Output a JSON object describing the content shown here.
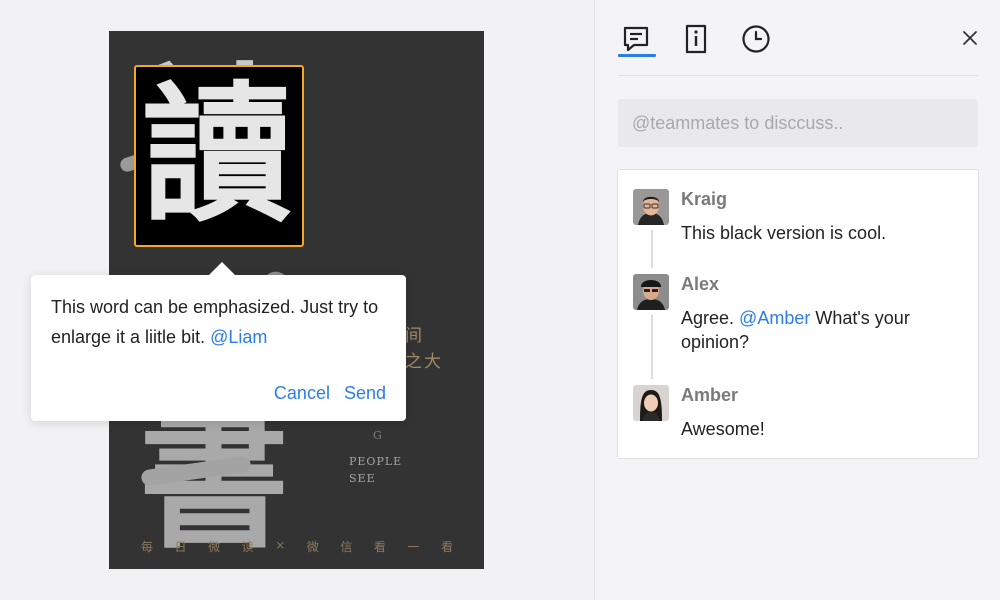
{
  "canvas": {
    "poster": {
      "title_glyph_1": "讀",
      "title_glyph_2": "書",
      "cjk_line_1": "间",
      "cjk_line_2": "之大",
      "en_line_1": "G",
      "en_line_2": "PEOPLE",
      "en_line_3": "SEE",
      "footer_chars": [
        "每",
        "日",
        "微",
        "读",
        "×",
        "微",
        "信",
        "看",
        "一",
        "看"
      ]
    },
    "selection": {
      "glyph": "讀",
      "border_color": "#f5a623"
    }
  },
  "popover": {
    "message": "This word can be emphasized. Just try to enlarge it a liitle bit. ",
    "mention": "@Liam",
    "cancel_label": "Cancel",
    "send_label": "Send"
  },
  "panel": {
    "tabs": [
      {
        "name": "comments",
        "icon": "comment-icon",
        "active": true
      },
      {
        "name": "info",
        "icon": "info-icon",
        "active": false
      },
      {
        "name": "history",
        "icon": "clock-icon",
        "active": false
      }
    ],
    "close_icon": "close-icon",
    "accent_color": "#2b7de9",
    "input_placeholder": "@teammates to disccuss..",
    "comments": [
      {
        "author": "Kraig",
        "text": "This black version is cool.",
        "mention": "",
        "text_after": ""
      },
      {
        "author": "Alex",
        "text": "Agree. ",
        "mention": "@Amber",
        "text_after": " What's your opinion?"
      },
      {
        "author": "Amber",
        "text": "Awesome!",
        "mention": "",
        "text_after": ""
      }
    ]
  }
}
